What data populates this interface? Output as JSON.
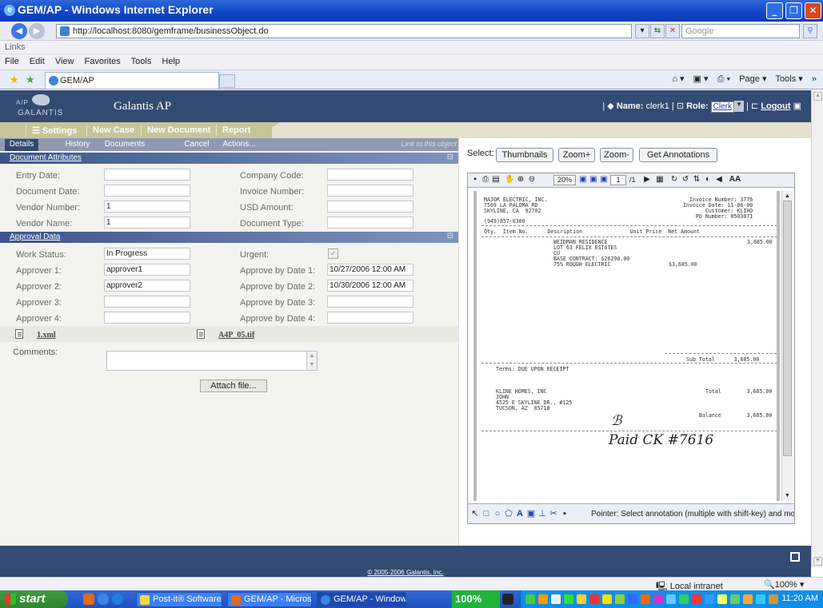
{
  "window": {
    "title": "GEM/AP - Windows Internet Explorer",
    "min": "_",
    "max": "❐",
    "close": "✕"
  },
  "addressbar": {
    "url": "http://localhost:8080/gemframe/businessObject.do",
    "search_placeholder": "Google"
  },
  "linksbar": {
    "label": "Links"
  },
  "menu": [
    "File",
    "Edit",
    "View",
    "Favorites",
    "Tools",
    "Help"
  ],
  "tab": {
    "label": "GEM/AP"
  },
  "commands": {
    "page": "Page ▾",
    "tools": "Tools ▾"
  },
  "app": {
    "logo_ap": "A/P",
    "logo_name": "GALANTIS",
    "name": "Galantis AP",
    "user_label": "Name:",
    "user": "clerk1",
    "role_label": "Role:",
    "role": "Clerk",
    "logout": "Logout"
  },
  "nav": [
    "Settings",
    "New Case",
    "New Document",
    "Report"
  ],
  "subtabs": [
    "Details",
    "History",
    "Documents",
    "Cancel",
    "Actions..."
  ],
  "link_to_object": "Link to this object",
  "sections": {
    "attributes": "Document Attributes",
    "approval": "Approval Data"
  },
  "doc_attributes": [
    {
      "label": "Entry Date:",
      "value": ""
    },
    {
      "label": "Document Date:",
      "value": ""
    },
    {
      "label": "Vendor Number:",
      "value": "1"
    },
    {
      "label": "Vendor Name:",
      "value": "1"
    }
  ],
  "doc_attributes_right": [
    {
      "label": "Company Code:",
      "value": ""
    },
    {
      "label": "Invoice Number:",
      "value": ""
    },
    {
      "label": "USD Amount:",
      "value": ""
    },
    {
      "label": "Document Type:",
      "value": ""
    }
  ],
  "approval_left": [
    {
      "label": "Work Status:",
      "value": "In Progress"
    },
    {
      "label": "Approver 1:",
      "value": "approver1"
    },
    {
      "label": "Approver 2:",
      "value": "approver2"
    },
    {
      "label": "Approver 3:",
      "value": ""
    },
    {
      "label": "Approver 4:",
      "value": ""
    }
  ],
  "approval_right": [
    {
      "label": "Urgent:",
      "value": "✓"
    },
    {
      "label": "Approve by Date 1:",
      "value": "10/27/2006 12:00 AM"
    },
    {
      "label": "Approve by Date 2:",
      "value": "10/30/2006 12:00 AM"
    },
    {
      "label": "Approve by Date 3:",
      "value": ""
    },
    {
      "label": "Approve by Date 4:",
      "value": ""
    }
  ],
  "files": [
    "1.xml",
    "A4P_05.tif"
  ],
  "comments_label": "Comments:",
  "attach_label": "Attach file...",
  "viewer": {
    "select_label": "Select:",
    "buttons": [
      "Thumbnails",
      "Zoom+",
      "Zoom-",
      "Get Annotations"
    ],
    "zoom": "20%",
    "page": "1",
    "page_of": "/1",
    "pointer_text": "Pointer: Select annotation (multiple with shift-key) and move, c"
  },
  "invoice": {
    "vendor": "MAJOR ELECTRIC, INC.\n7569 LA PALOMA RD\nSKYLINE, CA  92702",
    "phone": "(949)857-0300",
    "meta": "Invoice Number: 3776\n  Invoice Date: 11-06-00\n      Customer: KLIHO\n     PO Number: 8503071",
    "head": "Qty.  Item No.      Description               Unit Price  Net Amount",
    "desc": "WEIDMAN RESIDENCE\nLOT 63 FELIX ESTATES\nCU\nBASE CONTRACT: $26290.00\n75% ROUGH ELECTRIC",
    "unit": "$3,685.00",
    "net": "3,685.00",
    "subtotal": "Sub Total      3,685.00",
    "terms": "Terms: DUE UPON RECEIPT",
    "billto": "KLINE HOMES, INC\nJOHN\n4525 E SKYLINE DR., #125\nTUCSON, AZ  85718",
    "total": "Total        3,685.00",
    "balance": "Balance        3,685.00",
    "paid": "Paid CK #7616"
  },
  "copyright": "© 2005-2006 Galantis, Inc.",
  "status": {
    "zone": "Local intranet",
    "zoom": "100%"
  },
  "taskbar": {
    "start": "start",
    "items": [
      "Post-it® Software...",
      "GEM/AP - Microso...",
      "GEM/AP - Window..."
    ],
    "zoom": "100%",
    "clock": "11:20 AM"
  },
  "colors": {
    "header": "#334a72",
    "nav": "#c8c49a",
    "accent": "#1e49b0"
  }
}
